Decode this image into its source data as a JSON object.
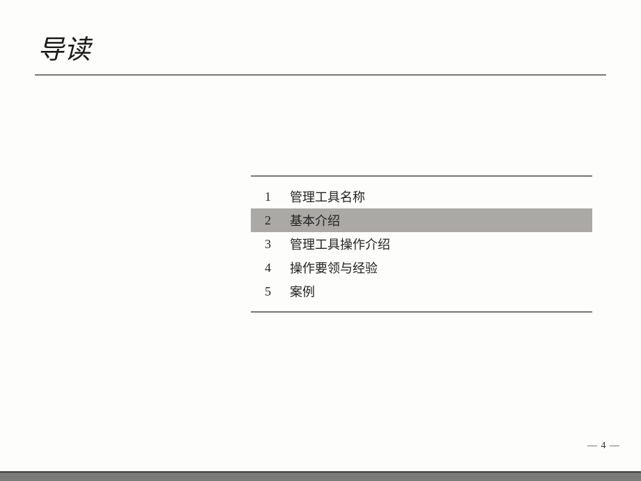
{
  "title": "导读",
  "toc": [
    {
      "num": "1",
      "label": "管理工具名称",
      "highlighted": false
    },
    {
      "num": "2",
      "label": "基本介绍",
      "highlighted": true
    },
    {
      "num": "3",
      "label": "管理工具操作介绍",
      "highlighted": false
    },
    {
      "num": "4",
      "label": "操作要领与经验",
      "highlighted": false
    },
    {
      "num": "5",
      "label": "案例",
      "highlighted": false
    }
  ],
  "pageNumber": "— 4 —"
}
